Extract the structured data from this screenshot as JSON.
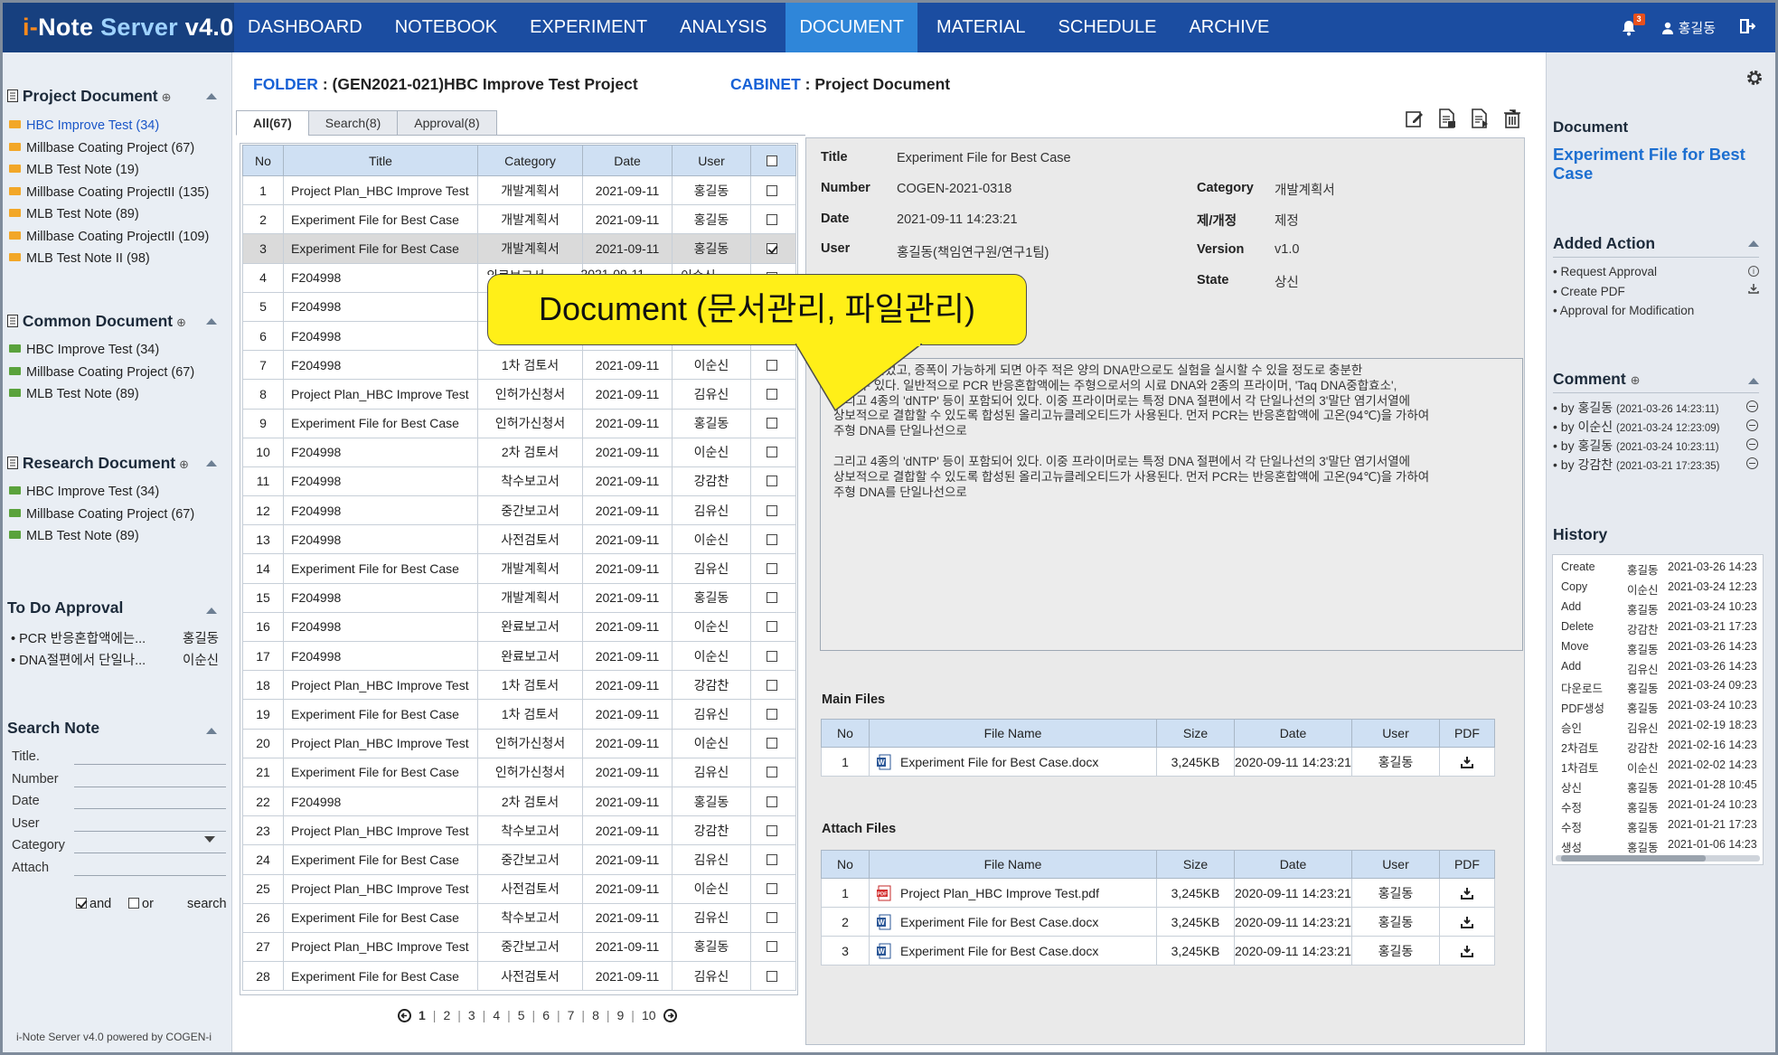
{
  "app": {
    "title_prefix": "i-",
    "title_main": "Note ",
    "title_server": "Server",
    "title_ver": " v4.0"
  },
  "nav": [
    "DASHBOARD",
    "NOTEBOOK",
    "EXPERIMENT",
    "ANALYSIS",
    "DOCUMENT",
    "MATERIAL",
    "SCHEDULE",
    "ARCHIVE"
  ],
  "nav_active": "DOCUMENT",
  "header": {
    "notification_count": "3",
    "user": "홍길동"
  },
  "sidebar": {
    "project": {
      "title": "Project Document",
      "items": [
        {
          "label": "HBC Improve Test (34)",
          "selected": true
        },
        {
          "label": "Millbase Coating Project (67)"
        },
        {
          "label": "MLB Test Note (19)"
        },
        {
          "label": "Millbase Coating ProjectII (135)"
        },
        {
          "label": "MLB Test Note (89)"
        },
        {
          "label": "Millbase Coating ProjectII (109)"
        },
        {
          "label": "MLB Test Note II (98)"
        }
      ]
    },
    "common": {
      "title": "Common Document",
      "items": [
        {
          "label": "HBC Improve Test (34)"
        },
        {
          "label": "Millbase Coating Project (67)"
        },
        {
          "label": "MLB Test Note (89)"
        }
      ]
    },
    "research": {
      "title": "Research Document",
      "items": [
        {
          "label": "HBC Improve Test (34)"
        },
        {
          "label": "Millbase Coating Project (67)"
        },
        {
          "label": "MLB Test Note (89)"
        }
      ]
    },
    "todo": {
      "title": "To Do Approval",
      "items": [
        {
          "text": "• PCR 반응혼합액에는...",
          "user": "홍길동"
        },
        {
          "text": "• DNA절편에서 단일나...",
          "user": "이순신"
        }
      ]
    },
    "search": {
      "title": "Search Note",
      "fields": [
        "Title.",
        "Number",
        "Date",
        "User",
        "Category",
        "Attach"
      ],
      "and_label": "and",
      "or_label": "or",
      "search_label": "search"
    },
    "footer": "i-Note Server v4.0 powered by COGEN-i"
  },
  "location": {
    "folder_label": "FOLDER",
    "folder_value": ": (GEN2021-021)HBC Improve Test Project",
    "cabinet_label": "CABINET",
    "cabinet_value": ": Project Document"
  },
  "tabs": [
    "All(67)",
    "Search(8)",
    "Approval(8)"
  ],
  "list": {
    "headers": [
      "No",
      "Title",
      "Category",
      "Date",
      "User"
    ],
    "rows": [
      {
        "no": "1",
        "title": "Project Plan_HBC Improve Test",
        "cat": "개발계획서",
        "date": "2021-09-11",
        "user": "홍길동",
        "checked": false
      },
      {
        "no": "2",
        "title": "Experiment File for Best Case",
        "cat": "개발계획서",
        "date": "2021-09-11",
        "user": "홍길동",
        "checked": false
      },
      {
        "no": "3",
        "title": "Experiment File for Best Case",
        "cat": "개발계획서",
        "date": "2021-09-11",
        "user": "홍길동",
        "checked": true
      },
      {
        "no": "4",
        "title": "F204998",
        "cat": "",
        "date": "",
        "user": "",
        "checked": false
      },
      {
        "no": "5",
        "title": "F204998",
        "cat": "",
        "date": "",
        "user": "",
        "checked": false
      },
      {
        "no": "6",
        "title": "F204998",
        "cat": "",
        "date": "",
        "user": "",
        "checked": false
      },
      {
        "no": "7",
        "title": "F204998",
        "cat": "1차 검토서",
        "date": "2021-09-11",
        "user": "이순신",
        "checked": false
      },
      {
        "no": "8",
        "title": "Project Plan_HBC Improve Test",
        "cat": "인허가신청서",
        "date": "2021-09-11",
        "user": "김유신",
        "checked": false
      },
      {
        "no": "9",
        "title": "Experiment File for Best Case",
        "cat": "인허가신청서",
        "date": "2021-09-11",
        "user": "홍길동",
        "checked": false
      },
      {
        "no": "10",
        "title": "F204998",
        "cat": "2차 검토서",
        "date": "2021-09-11",
        "user": "이순신",
        "checked": false
      },
      {
        "no": "11",
        "title": "F204998",
        "cat": "착수보고서",
        "date": "2021-09-11",
        "user": "강감찬",
        "checked": false
      },
      {
        "no": "12",
        "title": "F204998",
        "cat": "중간보고서",
        "date": "2021-09-11",
        "user": "김유신",
        "checked": false
      },
      {
        "no": "13",
        "title": "F204998",
        "cat": "사전검토서",
        "date": "2021-09-11",
        "user": "이순신",
        "checked": false
      },
      {
        "no": "14",
        "title": "Experiment File for Best Case",
        "cat": "개발계획서",
        "date": "2021-09-11",
        "user": "김유신",
        "checked": false
      },
      {
        "no": "15",
        "title": "F204998",
        "cat": "개발계획서",
        "date": "2021-09-11",
        "user": "홍길동",
        "checked": false
      },
      {
        "no": "16",
        "title": "F204998",
        "cat": "완료보고서",
        "date": "2021-09-11",
        "user": "이순신",
        "checked": false
      },
      {
        "no": "17",
        "title": "F204998",
        "cat": "완료보고서",
        "date": "2021-09-11",
        "user": "이순신",
        "checked": false
      },
      {
        "no": "18",
        "title": "Project Plan_HBC Improve Test",
        "cat": "1차 검토서",
        "date": "2021-09-11",
        "user": "강감찬",
        "checked": false
      },
      {
        "no": "19",
        "title": "Experiment File for Best Case",
        "cat": "1차 검토서",
        "date": "2021-09-11",
        "user": "김유신",
        "checked": false
      },
      {
        "no": "20",
        "title": "Project Plan_HBC Improve Test",
        "cat": "인허가신청서",
        "date": "2021-09-11",
        "user": "이순신",
        "checked": false
      },
      {
        "no": "21",
        "title": "Experiment File for Best Case",
        "cat": "인허가신청서",
        "date": "2021-09-11",
        "user": "김유신",
        "checked": false
      },
      {
        "no": "22",
        "title": "F204998",
        "cat": "2차 검토서",
        "date": "2021-09-11",
        "user": "홍길동",
        "checked": false
      },
      {
        "no": "23",
        "title": "Project Plan_HBC Improve Test",
        "cat": "착수보고서",
        "date": "2021-09-11",
        "user": "강감찬",
        "checked": false
      },
      {
        "no": "24",
        "title": "Experiment File for Best Case",
        "cat": "중간보고서",
        "date": "2021-09-11",
        "user": "김유신",
        "checked": false
      },
      {
        "no": "25",
        "title": "Project Plan_HBC Improve Test",
        "cat": "사전검토서",
        "date": "2021-09-11",
        "user": "이순신",
        "checked": false
      },
      {
        "no": "26",
        "title": "Experiment File for Best Case",
        "cat": "착수보고서",
        "date": "2021-09-11",
        "user": "김유신",
        "checked": false
      },
      {
        "no": "27",
        "title": "Project Plan_HBC Improve Test",
        "cat": "중간보고서",
        "date": "2021-09-11",
        "user": "홍길동",
        "checked": false
      },
      {
        "no": "28",
        "title": "Experiment File for Best Case",
        "cat": "사전검토서",
        "date": "2021-09-11",
        "user": "김유신",
        "checked": false
      }
    ],
    "row4_partial": {
      "cat": "의료보고서",
      "date": "2021-09-11",
      "user": "이순신"
    }
  },
  "pager": {
    "pages": [
      "1",
      "2",
      "3",
      "4",
      "5",
      "6",
      "7",
      "8",
      "9",
      "10"
    ],
    "current": "1"
  },
  "detail": {
    "title_label": "Title",
    "title_value": "Experiment File for Best Case",
    "number_label": "Number",
    "number_value": "COGEN-2021-0318",
    "date_label": "Date",
    "date_value": "2021-09-11 14:23:21",
    "user_label": "User",
    "user_value": "홍길동(책임연구원/연구1팀)",
    "category_label": "Category",
    "category_value": "개발계획서",
    "revision_label": "제/개정",
    "revision_value": "제정",
    "version_label": "Version",
    "version_value": "v1.0",
    "state_label": "State",
    "state_value": "상신",
    "desc_lines_1": [
      "양 하게 되었고, 증폭이 가능하게 되면 아주 적은 양의 DNA만으로도 실험을 실시할 수 있을 정도로 충분한",
      "양을    수 있다. 일반적으로 PCR 반응혼합액에는 주형으로서의 시료 DNA와 2종의 프라이머, 'Taq DNA중합효소',",
      "그리고 4종의 'dNTP' 등이 포함되어 있다. 이중 프라이머로는 특정 DNA 절편에서 각 단일나선의 3'말단 염기서열에",
      "상보적으로 결합할 수 있도록 합성된 올리고뉴클레오티드가 사용된다. 먼저 PCR는 반응혼합액에 고온(94℃)을 가하여",
      "주형 DNA를 단일나선으로"
    ],
    "desc_lines_2": [
      "그리고 4종의 'dNTP' 등이 포함되어 있다. 이중 프라이머로는 특정 DNA 절편에서 각 단일나선의 3'말단 염기서열에",
      "상보적으로 결합할 수 있도록 합성된 올리고뉴클레오티드가 사용된다. 먼저 PCR는 반응혼합액에 고온(94℃)을 가하여",
      "주형 DNA를 단일나선으로"
    ],
    "main_files_title": "Main Files",
    "attach_files_title": "Attach Files",
    "file_headers": [
      "No",
      "File Name",
      "Size",
      "Date",
      "User",
      "PDF"
    ],
    "main_files": [
      {
        "no": "1",
        "name": "Experiment File for Best Case.docx",
        "type": "word",
        "size": "3,245KB",
        "date": "2020-09-11 14:23:21",
        "user": "홍길동"
      }
    ],
    "attach_files": [
      {
        "no": "1",
        "name": "Project Plan_HBC Improve Test.pdf",
        "type": "pdf",
        "size": "3,245KB",
        "date": "2020-09-11 14:23:21",
        "user": "홍길동"
      },
      {
        "no": "2",
        "name": "Experiment File for Best Case.docx",
        "type": "word",
        "size": "3,245KB",
        "date": "2020-09-11 14:23:21",
        "user": "홍길동"
      },
      {
        "no": "3",
        "name": "Experiment File for Best Case.docx",
        "type": "word",
        "size": "3,245KB",
        "date": "2020-09-11 14:23:21",
        "user": "홍길동"
      }
    ]
  },
  "callout": "Document (문서관리, 파일관리)",
  "right": {
    "doc_label": "Document",
    "doc_title": "Experiment File for Best Case",
    "added_action_title": "Added Action",
    "actions": [
      "• Request Approval",
      "• Create PDF",
      "• Approval for Modification"
    ],
    "comment_title": "Comment",
    "comments": [
      {
        "by": "• by 홍길동",
        "ts": "(2021-03-26 14:23:11)"
      },
      {
        "by": "• by 이순신",
        "ts": "(2021-03-24 12:23:09)"
      },
      {
        "by": "• by 홍길동",
        "ts": "(2021-03-24 10:23:11)"
      },
      {
        "by": "• by 강감찬",
        "ts": "(2021-03-21 17:23:35)"
      }
    ],
    "history_title": "History",
    "history": [
      {
        "a": "Create",
        "u": "홍길동",
        "d": "2021-03-26 14:23"
      },
      {
        "a": "Copy",
        "u": "이순신",
        "d": "2021-03-24 12:23"
      },
      {
        "a": "Add",
        "u": "홍길동",
        "d": "2021-03-24 10:23"
      },
      {
        "a": "Delete",
        "u": "강감찬",
        "d": "2021-03-21 17:23"
      },
      {
        "a": "Move",
        "u": "홍길동",
        "d": "2021-03-26 14:23"
      },
      {
        "a": "Add",
        "u": "김유신",
        "d": "2021-03-26 14:23"
      },
      {
        "a": "다운로드",
        "u": "홍길동",
        "d": "2021-03-24 09:23"
      },
      {
        "a": "PDF생성",
        "u": "홍길동",
        "d": "2021-03-24 10:23"
      },
      {
        "a": "승인",
        "u": "김유신",
        "d": "2021-02-19 18:23"
      },
      {
        "a": "2차검토",
        "u": "강감찬",
        "d": "2021-02-16 14:23"
      },
      {
        "a": "1차검토",
        "u": "이순신",
        "d": "2021-02-02 14:23"
      },
      {
        "a": "상신",
        "u": "홍길동",
        "d": "2021-01-28 10:45"
      },
      {
        "a": "수정",
        "u": "홍길동",
        "d": "2021-01-24 10:23"
      },
      {
        "a": "수정",
        "u": "홍길동",
        "d": "2021-01-21 17:23"
      },
      {
        "a": "생성",
        "u": "홍길동",
        "d": "2021-01-06 14:23"
      }
    ]
  }
}
